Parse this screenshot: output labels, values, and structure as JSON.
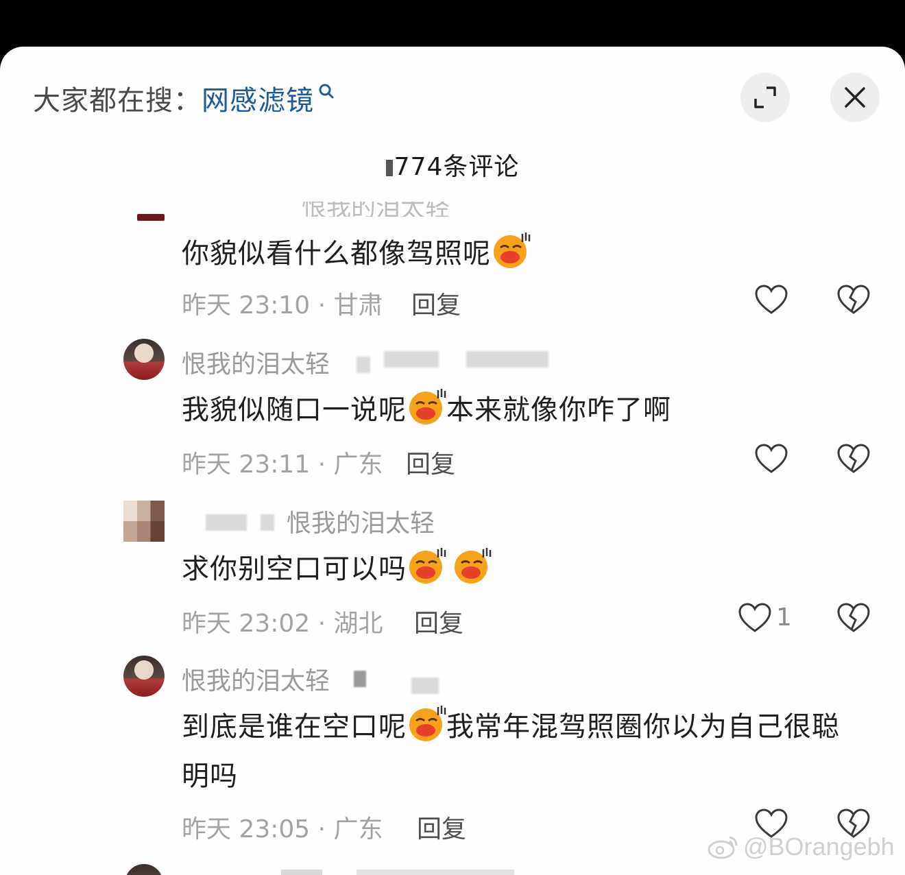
{
  "header": {
    "search_prefix": "大家都在搜：",
    "search_keyword": "网感滤镜",
    "comment_count": "774条评论"
  },
  "top_cut": {
    "text": "恨我的泪太轻"
  },
  "comments": [
    {
      "text_before": "你貌似看什么都像驾照呢",
      "text_after": "",
      "time_location": "昨天 23:10 · 甘肃",
      "reply_label": "回复"
    },
    {
      "username": "恨我的泪太轻",
      "text_before": "我貌似随口一说呢",
      "text_after": "本来就像你咋了啊",
      "time_location": "昨天 23:11 · 广东",
      "reply_label": "回复"
    },
    {
      "username": "恨我的泪太轻",
      "text_before": "求你别空口可以吗",
      "text_after": "",
      "time_location": "昨天 23:02 · 湖北",
      "reply_label": "回复",
      "like_count": "1"
    },
    {
      "username": "恨我的泪太轻",
      "text_before": "到底是谁在空口呢",
      "text_after": "我常年混驾照圈你以为自己很聪明吗",
      "time_location": "昨天 23:05 · 广东",
      "reply_label": "回复"
    }
  ],
  "watermark": "@BOrangebh",
  "colors": {
    "keyword": "#1e5a9c",
    "meta": "#a3a3a3",
    "text": "#1f1f1f",
    "emoji_face": "#f7a21b",
    "emoji_lips": "#e8402b"
  },
  "icons": [
    "search-icon",
    "expand-icon",
    "close-icon",
    "heart-icon",
    "broken-heart-icon",
    "smirk-emoji-icon",
    "weibo-logo-icon"
  ]
}
